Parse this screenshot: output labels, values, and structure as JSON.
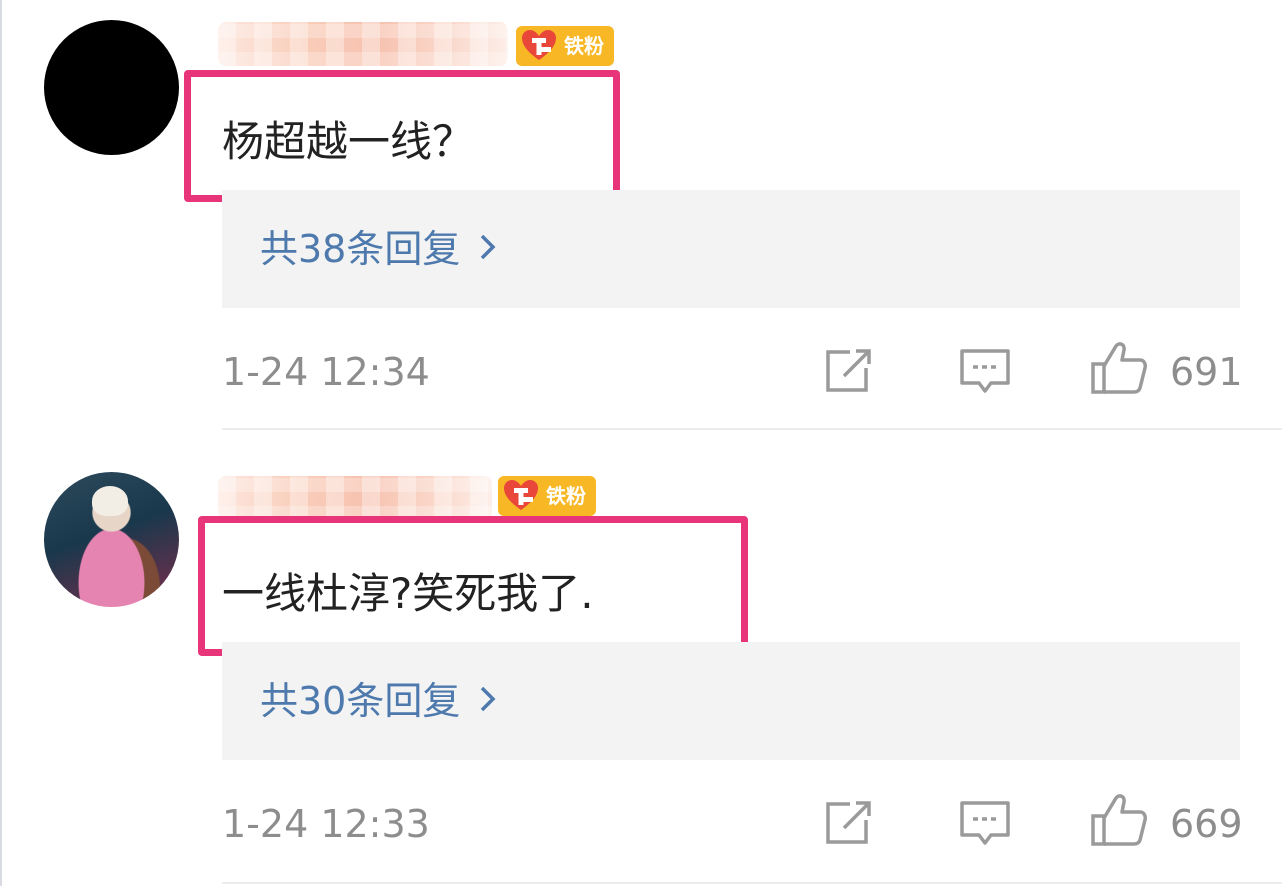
{
  "comments": [
    {
      "badge": "铁粉",
      "text": "杨超越一线？",
      "replies": "共38条回复",
      "time": "1-24 12:34",
      "likes": "691"
    },
    {
      "badge": "铁粉",
      "text": "一线杜淳?笑死我了.",
      "replies": "共30条回复",
      "time": "1-24 12:33",
      "likes": "669"
    }
  ],
  "colors": {
    "highlight": "#e8357a",
    "link": "#4d79ad",
    "badge": "#f8b825",
    "muted": "#8d8d8d"
  },
  "icons": [
    "chevron-right-icon",
    "share-icon",
    "comment-icon",
    "like-icon",
    "fan-badge-icon"
  ]
}
